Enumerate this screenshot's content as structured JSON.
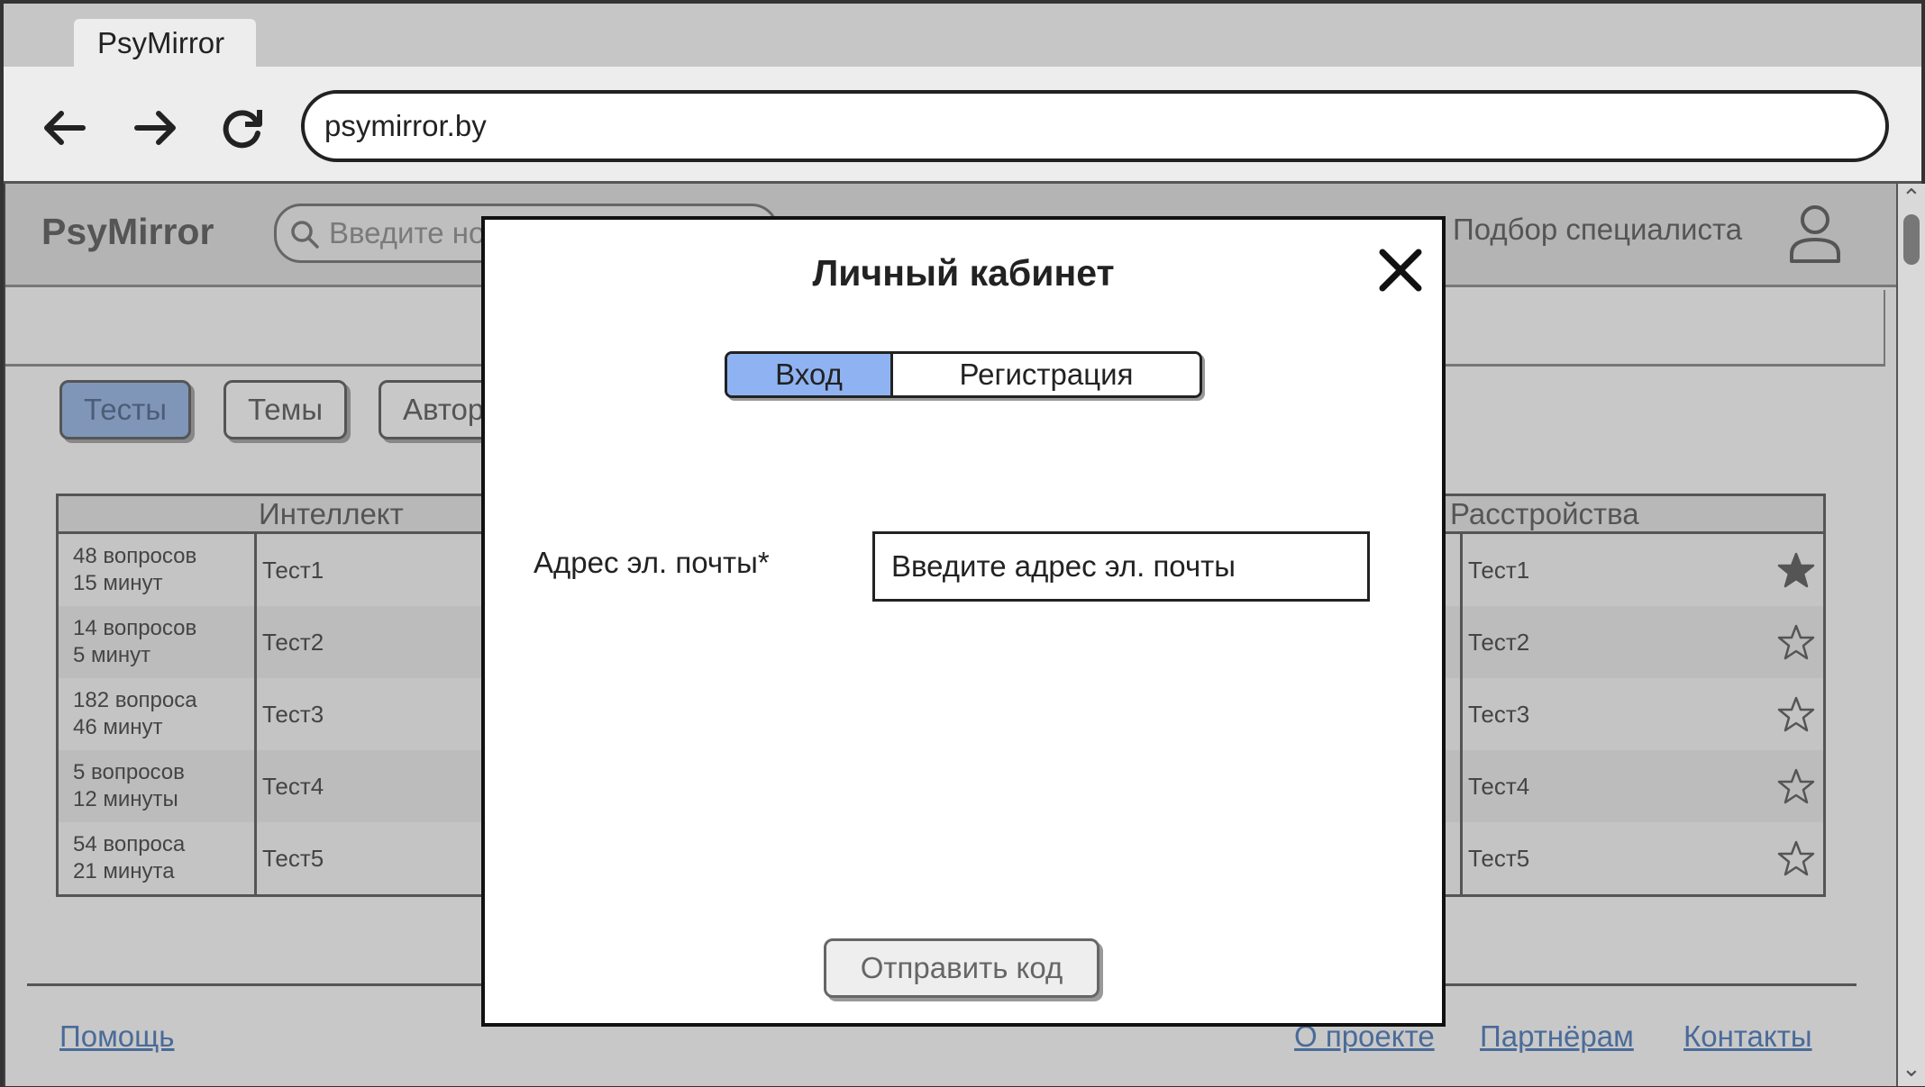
{
  "browser": {
    "tab_title": "PsyMirror",
    "url": "psymirror.by"
  },
  "site": {
    "logo": "PsyMirror",
    "search_placeholder": "Введите но",
    "specialist_link": "Подбор специалиста",
    "nav_pills": [
      {
        "label": "Тесты",
        "active": true
      },
      {
        "label": "Темы",
        "active": false
      },
      {
        "label": "Автор",
        "active": false
      }
    ],
    "left_table": {
      "header": "Интеллект",
      "rows": [
        {
          "meta1": "48 вопросов",
          "meta2": "15 минут",
          "name": "Тест1"
        },
        {
          "meta1": "14 вопросов",
          "meta2": "5 минут",
          "name": "Тест2"
        },
        {
          "meta1": "182 вопроса",
          "meta2": "46 минут",
          "name": "Тест3"
        },
        {
          "meta1": "5 вопросов",
          "meta2": "12 минуты",
          "name": "Тест4"
        },
        {
          "meta1": "54 вопроса",
          "meta2": "21 минута",
          "name": "Тест5"
        }
      ]
    },
    "right_table": {
      "header": "Расстройства",
      "rows": [
        {
          "name": "Тест1",
          "starred": true
        },
        {
          "name": "Тест2",
          "starred": false
        },
        {
          "name": "Тест3",
          "starred": false
        },
        {
          "name": "Тест4",
          "starred": false
        },
        {
          "name": "Тест5",
          "starred": false
        }
      ]
    },
    "footer": {
      "help": "Помощь",
      "about": "О проекте",
      "partners": "Партнёрам",
      "contacts": "Контакты"
    }
  },
  "modal": {
    "title": "Личный кабинет",
    "tab_login": "Вход",
    "tab_register": "Регистрация",
    "email_label": "Адрес эл. почты*",
    "email_placeholder": "Введите адрес эл. почты",
    "send_button": "Отправить код"
  },
  "colors": {
    "active_tab": "#8fb3f2",
    "link": "#4a6b99"
  }
}
